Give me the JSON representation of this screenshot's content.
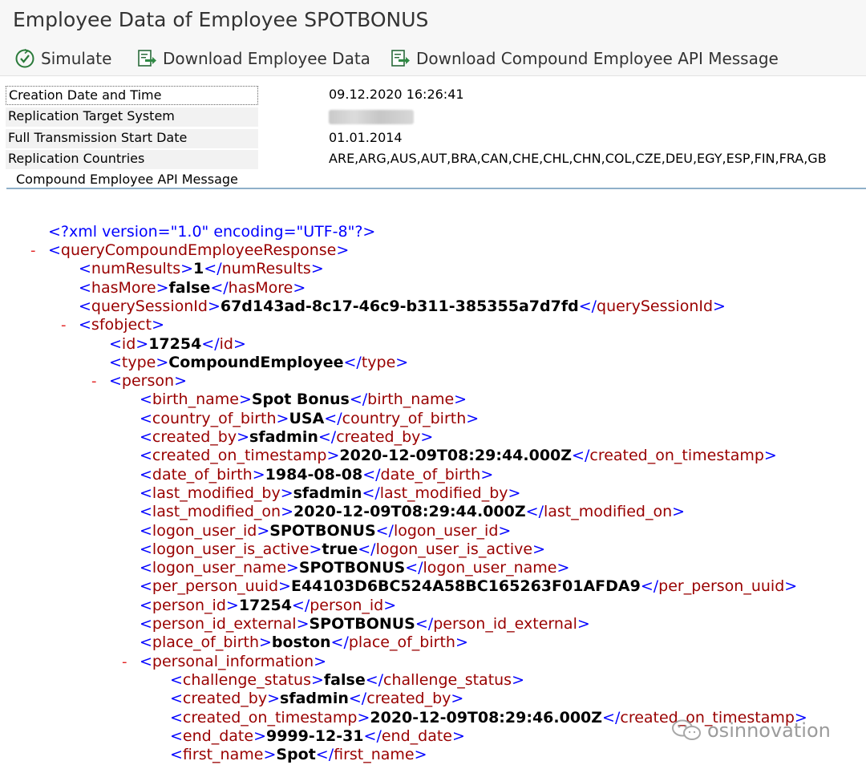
{
  "window": {
    "title": "Employee Data of Employee SPOTBONUS"
  },
  "toolbar": {
    "simulate": "Simulate",
    "download_employee": "Download Employee Data",
    "download_api": "Download Compound Employee API Message"
  },
  "info_rows": [
    {
      "label": "Creation Date and Time",
      "value": "09.12.2020 16:26:41"
    },
    {
      "label": "Replication Target System",
      "value": ""
    },
    {
      "label": "Full Transmission Start Date",
      "value": "01.01.2014"
    },
    {
      "label": "Replication Countries",
      "value": "ARE,ARG,AUS,AUT,BRA,CAN,CHE,CHL,CHN,COL,CZE,DEU,EGY,ESP,FIN,FRA,GB"
    }
  ],
  "section": {
    "title": "Compound Employee API Message"
  },
  "xml": {
    "declaration": "<?xml version=\"1.0\" encoding=\"UTF-8\"?>",
    "lines": [
      {
        "depth": 0,
        "collapsible": true,
        "tag": "queryCompoundEmployeeResponse"
      },
      {
        "depth": 1,
        "tag": "numResults",
        "text": "1"
      },
      {
        "depth": 1,
        "tag": "hasMore",
        "text": "false"
      },
      {
        "depth": 1,
        "tag": "querySessionId",
        "text": "67d143ad-8c17-46c9-b311-385355a7d7fd"
      },
      {
        "depth": 1,
        "collapsible": true,
        "tag": "sfobject"
      },
      {
        "depth": 2,
        "tag": "id",
        "text": "17254"
      },
      {
        "depth": 2,
        "tag": "type",
        "text": "CompoundEmployee"
      },
      {
        "depth": 2,
        "collapsible": true,
        "tag": "person"
      },
      {
        "depth": 3,
        "tag": "birth_name",
        "text": "Spot Bonus"
      },
      {
        "depth": 3,
        "tag": "country_of_birth",
        "text": "USA"
      },
      {
        "depth": 3,
        "tag": "created_by",
        "text": "sfadmin"
      },
      {
        "depth": 3,
        "tag": "created_on_timestamp",
        "text": "2020-12-09T08:29:44.000Z"
      },
      {
        "depth": 3,
        "tag": "date_of_birth",
        "text": "1984-08-08"
      },
      {
        "depth": 3,
        "tag": "last_modified_by",
        "text": "sfadmin"
      },
      {
        "depth": 3,
        "tag": "last_modified_on",
        "text": "2020-12-09T08:29:44.000Z"
      },
      {
        "depth": 3,
        "tag": "logon_user_id",
        "text": "SPOTBONUS"
      },
      {
        "depth": 3,
        "tag": "logon_user_is_active",
        "text": "true"
      },
      {
        "depth": 3,
        "tag": "logon_user_name",
        "text": "SPOTBONUS"
      },
      {
        "depth": 3,
        "tag": "per_person_uuid",
        "text": "E44103D6BC524A58BC165263F01AFDA9"
      },
      {
        "depth": 3,
        "tag": "person_id",
        "text": "17254"
      },
      {
        "depth": 3,
        "tag": "person_id_external",
        "text": "SPOTBONUS"
      },
      {
        "depth": 3,
        "tag": "place_of_birth",
        "text": "boston"
      },
      {
        "depth": 3,
        "collapsible": true,
        "tag": "personal_information"
      },
      {
        "depth": 4,
        "tag": "challenge_status",
        "text": "false"
      },
      {
        "depth": 4,
        "tag": "created_by",
        "text": "sfadmin"
      },
      {
        "depth": 4,
        "tag": "created_on_timestamp",
        "text": "2020-12-09T08:29:46.000Z"
      },
      {
        "depth": 4,
        "tag": "end_date",
        "text": "9999-12-31"
      },
      {
        "depth": 4,
        "tag": "first_name",
        "text": "Spot"
      }
    ]
  },
  "watermark": {
    "text": "osinnovation"
  },
  "colors": {
    "bracket": "#0000ff",
    "tag": "#990000",
    "collapse": "#e32222",
    "accent": "#8fb0c9"
  }
}
